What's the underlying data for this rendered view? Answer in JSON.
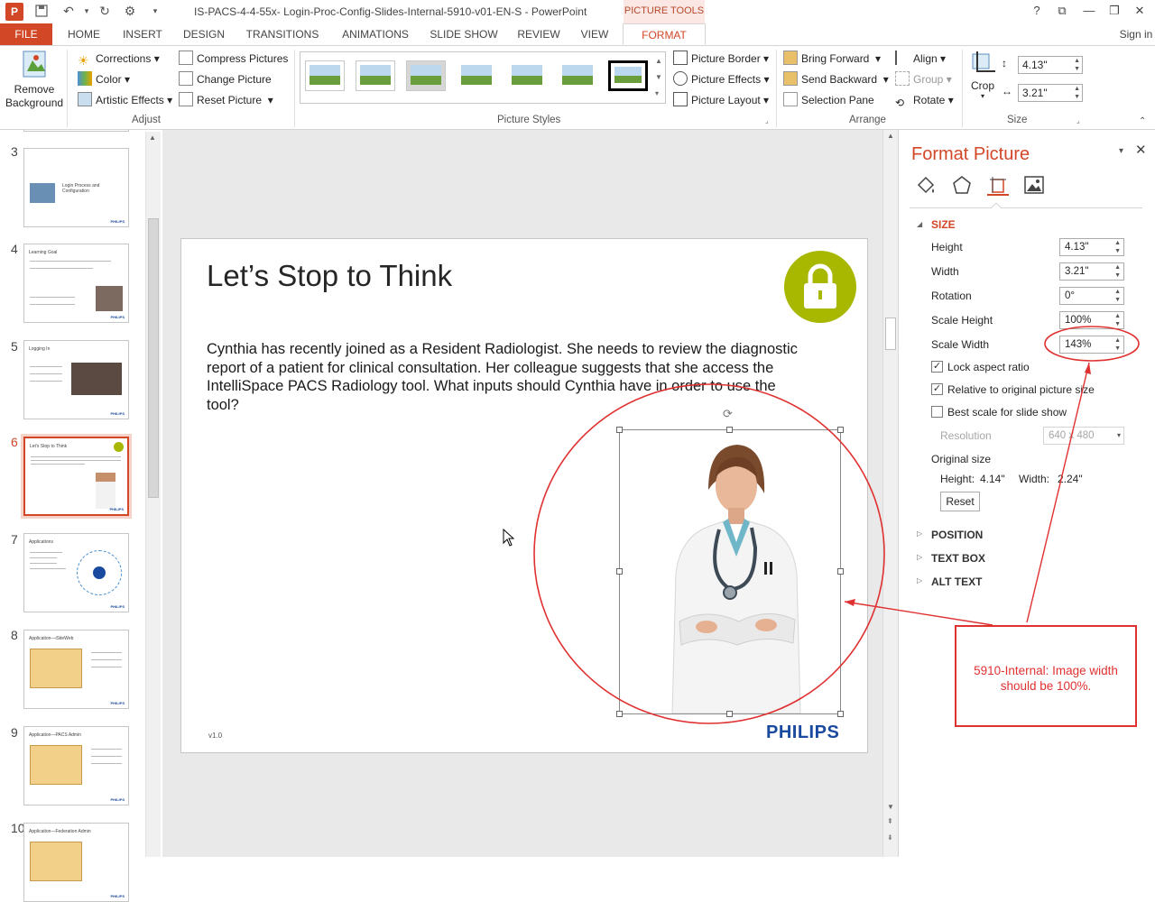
{
  "window": {
    "title": "IS-PACS-4-4-55x- Login-Proc-Config-Slides-Internal-5910-v01-EN-S - PowerPoint",
    "context_tab_group": "PICTURE TOOLS",
    "sign_in": "Sign in"
  },
  "tabs": [
    "FILE",
    "HOME",
    "INSERT",
    "DESIGN",
    "TRANSITIONS",
    "ANIMATIONS",
    "SLIDE SHOW",
    "REVIEW",
    "VIEW",
    "FORMAT"
  ],
  "ribbon": {
    "remove_background": "Remove Background",
    "corrections": "Corrections",
    "color": "Color",
    "artistic_effects": "Artistic Effects",
    "compress_pictures": "Compress Pictures",
    "change_picture": "Change Picture",
    "reset_picture": "Reset Picture",
    "group_adjust": "Adjust",
    "group_picture_styles": "Picture Styles",
    "picture_border": "Picture Border",
    "picture_effects": "Picture Effects",
    "picture_layout": "Picture Layout",
    "bring_forward": "Bring Forward",
    "send_backward": "Send Backward",
    "selection_pane": "Selection Pane",
    "align": "Align",
    "group": "Group",
    "rotate": "Rotate",
    "group_arrange": "Arrange",
    "crop": "Crop",
    "height": "4.13\"",
    "width": "3.21\"",
    "group_size": "Size"
  },
  "thumbnails": [
    {
      "num": "3",
      "title": "Login Process and Configuration"
    },
    {
      "num": "4",
      "title": "Learning Goal"
    },
    {
      "num": "5",
      "title": "Logging In"
    },
    {
      "num": "6",
      "title": "Let's Stop to Think"
    },
    {
      "num": "7",
      "title": "Applications"
    },
    {
      "num": "8",
      "title": "Application—iSiteWeb"
    },
    {
      "num": "9",
      "title": "Application—PACS Admin"
    },
    {
      "num": "10",
      "title": "Application—Federation Admin"
    }
  ],
  "thumb_brand": "PHILIPS",
  "slide": {
    "title": "Let’s Stop to Think",
    "body": "Cynthia has recently joined as a Resident Radiologist. She needs to review the diagnostic report of a patient for clinical consultation. Her colleague suggests that she access the IntelliSpace PACS Radiology tool. What inputs should Cynthia have in order to use the tool?",
    "version": "v1.0",
    "brand": "PHILIPS"
  },
  "format_pane": {
    "title": "Format Picture",
    "section_size": "SIZE",
    "height_label": "Height",
    "height_value": "4.13\"",
    "width_label": "Width",
    "width_value": "3.21\"",
    "rotation_label": "Rotation",
    "rotation_value": "0°",
    "scale_height_label": "Scale Height",
    "scale_height_value": "100%",
    "scale_width_label": "Scale Width",
    "scale_width_value": "143%",
    "lock_aspect": "Lock aspect ratio",
    "relative_original": "Relative to original picture size",
    "best_scale": "Best scale for slide show",
    "resolution_label": "Resolution",
    "resolution_value": "640 x 480",
    "original_size_label": "Original size",
    "orig_height_label": "Height:",
    "orig_height_value": "4.14\"",
    "orig_width_label": "Width:",
    "orig_width_value": "2.24\"",
    "reset_button": "Reset",
    "section_position": "POSITION",
    "section_textbox": "TEXT BOX",
    "section_alttext": "ALT TEXT"
  },
  "annotation": {
    "text": "5910-Internal: Image width should be 100%.",
    "color": "#e03131"
  },
  "colors": {
    "accent": "#d24726",
    "lime": "#a8b700",
    "philips_blue": "#1a4a9f"
  }
}
